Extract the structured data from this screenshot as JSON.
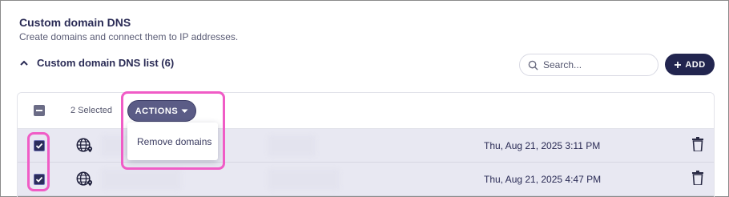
{
  "section": {
    "title": "Custom domain DNS",
    "subtitle": "Create domains and connect them to IP addresses."
  },
  "list": {
    "title": "Custom domain DNS list (6)",
    "chevron_icon": "chevron-up-icon"
  },
  "search": {
    "placeholder": "Search...",
    "value": "",
    "icon": "search-icon"
  },
  "add_button": {
    "label": "ADD",
    "icon": "plus-icon"
  },
  "toolbar": {
    "selected_label": "2 Selected",
    "actions_label": "ACTIONS",
    "actions_icon": "caret-down-icon"
  },
  "actions_menu": {
    "items": [
      "Remove domains"
    ]
  },
  "rows": [
    {
      "selected": true,
      "icon": "globe-icon",
      "date": "Thu, Aug 21, 2025 3:11 PM",
      "delete_icon": "trash-icon"
    },
    {
      "selected": true,
      "icon": "globe-icon",
      "date": "Thu, Aug 21, 2025 4:47 PM",
      "delete_icon": "trash-icon"
    }
  ],
  "colors": {
    "primary": "#22254f",
    "accent": "#5b5c86",
    "row_selected_bg": "#e8e8f2",
    "highlight": "#f05cc6"
  }
}
